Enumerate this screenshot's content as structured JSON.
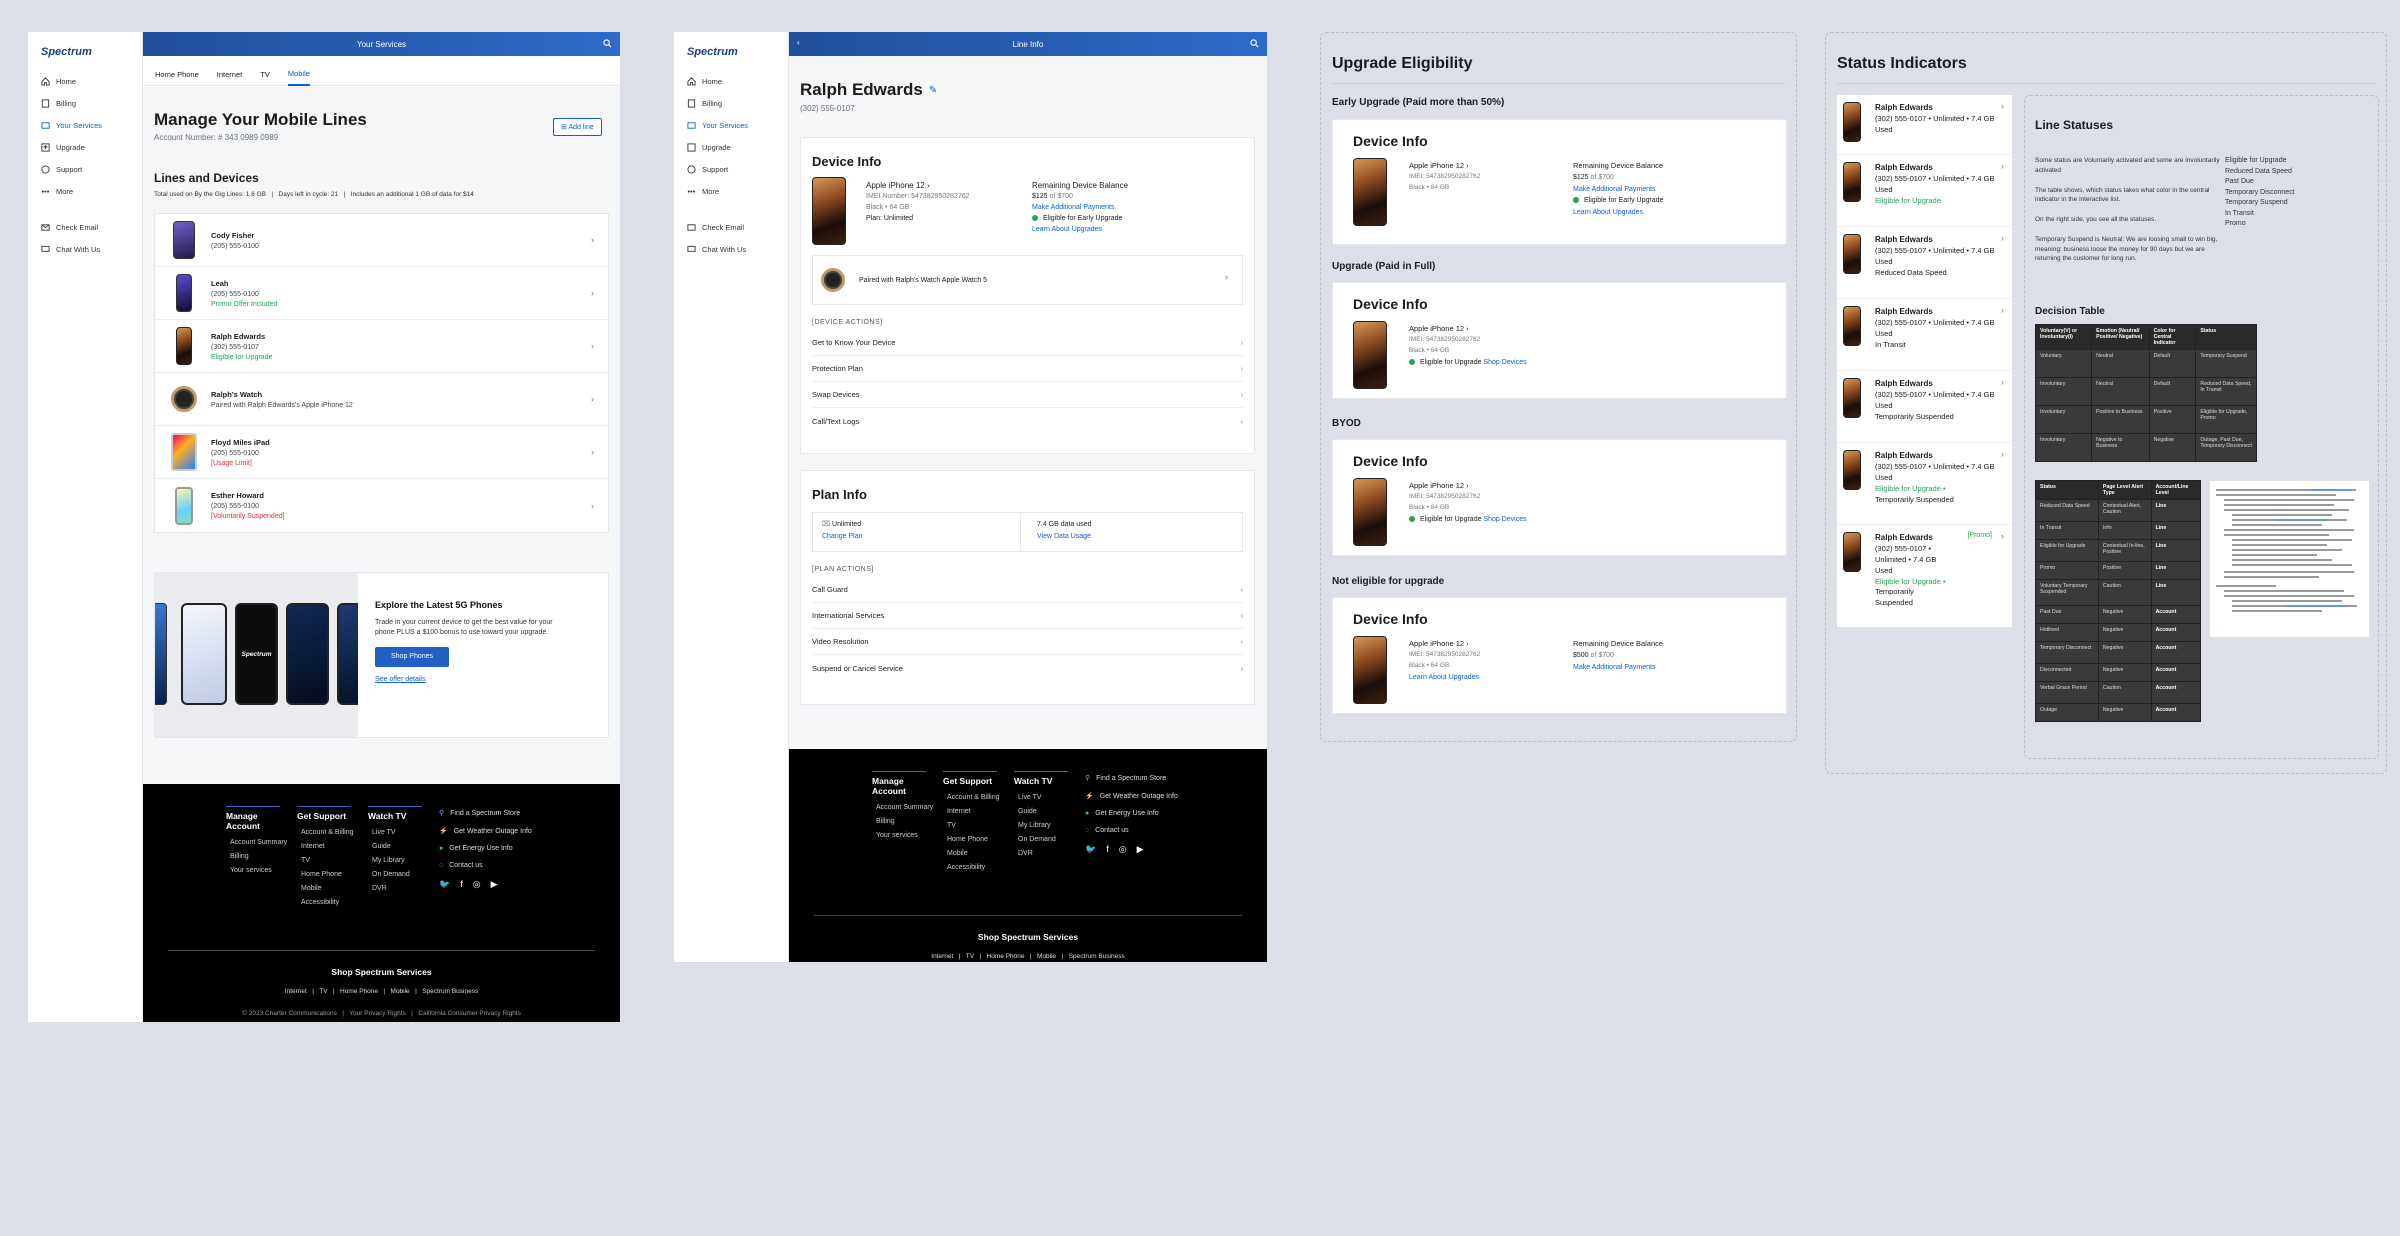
{
  "nav": {
    "logo": "Spectrum",
    "items": [
      "Home",
      "Billing",
      "Your Services",
      "Upgrade",
      "Support",
      "More"
    ],
    "extra": [
      "Check Email",
      "Chat With Us"
    ]
  },
  "screen1": {
    "topbar": "Your Services",
    "tabs": [
      "Home Phone",
      "Internet",
      "TV",
      "Mobile"
    ],
    "title": "Manage Your Mobile Lines",
    "account": "Account Number: # 343 0989 0989",
    "add_line": "Add line",
    "lines_title": "Lines and Devices",
    "usage_info": "Total used on By the Gig Lines: 1.6 GB   |   Days left in cycle: 21   |   Includes an additional 1 GB of data for $14",
    "lines": [
      {
        "name": "Cody Fisher",
        "phone": "(205) 555-0100",
        "status": ""
      },
      {
        "name": "Leah",
        "phone": "(205) 555-0100",
        "status": "Promo Offer Included"
      },
      {
        "name": "Ralph Edwards",
        "phone": "(302) 555-0107",
        "status": "Eligible for Upgrade"
      },
      {
        "name": "Ralph's Watch",
        "phone": "Paired with Ralph Edwards's Apple iPhone 12",
        "status": ""
      },
      {
        "name": "Floyd Miles iPad",
        "phone": "(205) 555-0100",
        "status": "[Usage Limit]"
      },
      {
        "name": "Esther Howard",
        "phone": "(205) 555-0100",
        "status": "[Voluntarily Suspended]"
      }
    ],
    "promo": {
      "title": "Explore the Latest 5G Phones",
      "body": "Trade in your current device to get the best value for your phone PLUS a $100 bonus to use toward your upgrade.",
      "button": "Shop Phones",
      "link": "See offer details",
      "phone_brand": "Spectrum"
    }
  },
  "screen2": {
    "topbar": "Line Info",
    "name": "Ralph Edwards",
    "phone": "(302) 555-0107",
    "device_info_title": "Device Info",
    "device": {
      "model": "Apple iPhone 12",
      "imei": "IMEI Number: 547382950282762",
      "spec": "Black  •  64 GB",
      "plan": "Plan: Unlimited"
    },
    "balance": {
      "label": "Remaining Device Balance",
      "amount": "$125",
      "of": "of $700",
      "payments": "Make Additional Payments",
      "eligible": "Eligible for Early Upgrade",
      "learn": "Learn About Upgrades"
    },
    "paired": "Paired with Ralph's Watch Apple Watch 5",
    "device_actions_label": "[DEVICE ACTIONS]",
    "device_actions": [
      "Get to Know Your Device",
      "Protection Plan",
      "Swap Devices",
      "Call/Text Logs"
    ],
    "plan_title": "Plan Info",
    "plan": {
      "name": "Unlimited",
      "change": "Change Plan",
      "data": "7.4 GB data used",
      "view": "View Data Usage"
    },
    "plan_actions_label": "[PLAN ACTIONS]",
    "plan_actions": [
      "Call Guard",
      "International Services",
      "Video Resolution",
      "Suspend  or Cancel Service"
    ]
  },
  "footer": {
    "cols": [
      {
        "title": "Manage Account",
        "items": [
          "Account Summary",
          "Billing",
          "Your services"
        ]
      },
      {
        "title": "Get Support",
        "items": [
          "Account & Billing",
          "Internet",
          "TV",
          "Home Phone",
          "Mobile",
          "Accessibility"
        ]
      },
      {
        "title": "Watch TV",
        "items": [
          "Live TV",
          "Guide",
          "My Library",
          "On Demand",
          "DVR"
        ]
      }
    ],
    "side": [
      "Find a Spectrum Store",
      "Get Weather Outage Info",
      "Get Energy Use Info",
      "Contact us"
    ],
    "shop": "Shop Spectrum Services",
    "links": "Internet   |   TV   |   Home Phone   |   Mobile   |   Spectrum Business",
    "copyright": "© 2023 Charter Communications   |   Your Privacy Rights   |   California Consumer Privacy Rights"
  },
  "upgrade": {
    "title": "Upgrade Eligibility",
    "groups": [
      {
        "label": "Early Upgrade (Paid more than 50%)",
        "device": "Apple iPhone 12",
        "imei": "IMEI: 547382950282762",
        "spec": "Black  •  64 GB",
        "balance_label": "Remaining Device Balance",
        "balance": "$125",
        "of": "of $700",
        "pay": "Make Additional Payments",
        "eligible": "Eligible for Early Upgrade",
        "learn": "Learn About Upgrades"
      },
      {
        "label": "Upgrade (Paid in Full)",
        "device": "Apple iPhone 12",
        "imei": "IMEI: 547382950282762",
        "spec": "Black  •  64 GB",
        "eligible": "Eligible for Upgrade",
        "shop": "Shop Devices"
      },
      {
        "label": "BYOD",
        "device": "Apple iPhone 12",
        "imei": "IMEI: 547382950282762",
        "spec": "Black  •  64 GB",
        "eligible": "Eligible for Upgrade",
        "shop": "Shop Devices"
      },
      {
        "label": "Not eligible for upgrade",
        "device": "Apple iPhone 12",
        "imei": "IMEI: 547382950282762",
        "spec": "Black  •  64 GB",
        "learn": "Learn About Upgrades",
        "balance_label": "Remaining Device Balance",
        "balance": "$500",
        "of": "of $700",
        "pay": "Make Additional Payments"
      }
    ],
    "device_info": "Device Info"
  },
  "status": {
    "title": "Status Indicators",
    "rows": [
      {
        "name": "Ralph Edwards",
        "detail": "(302) 555-0107  •  Unlimited  •  7.4 GB Used",
        "status": ""
      },
      {
        "name": "Ralph Edwards",
        "detail": "(302) 555-0107  •  Unlimited  •  7.4 GB Used",
        "status": "Eligible for Upgrade"
      },
      {
        "name": "Ralph Edwards",
        "detail": "(302) 555-0107  •  Unlimited  •  7.4 GB Used",
        "status": "Reduced Data Speed"
      },
      {
        "name": "Ralph Edwards",
        "detail": "(302) 555-0107  •  Unlimited  •  7.4 GB Used",
        "status": "In Transit"
      },
      {
        "name": "Ralph Edwards",
        "detail": "(302) 555-0107  •  Unlimited  •  7.4 GB Used",
        "status": "Temporarily Suspended"
      },
      {
        "name": "Ralph Edwards",
        "detail": "(302) 555-0107  •  Unlimited  •  7.4 GB Used",
        "status": "Eligible for Upgrade  •",
        "status2": "Temporarily Suspended"
      },
      {
        "name": "Ralph Edwards",
        "detail": "(302) 555-0107  •  Unlimited  •  7.4 GB Used",
        "status": "Eligible for Upgrade  •",
        "status2": "Temporarily Suspended",
        "promo": "[Promo]"
      }
    ],
    "line_statuses": {
      "title": "Line Statuses",
      "p1": "Some status are Voluntarily activated and some are involuntarily activated",
      "p2": "The table shows, which status takes what color in the central indicator in the interactive list.",
      "p3": "On the right side, you see all the statuses.",
      "p4": "Temporary Suspend is Neutral: We are loosing small to win big, meaning: business loose the money for 90 days but we are returning the customer for long run.",
      "list": [
        "Eligible for Upgrade",
        "Reduced Data Speed",
        "Past Due",
        "Temporary Disconnect",
        "Temporary Suspend",
        "In Transit",
        "Promo"
      ],
      "decision": "Decision Table"
    },
    "table1": {
      "head": [
        "Voluntary(V) or Involuntary(I)",
        "Emotion (Neutral/ Positive/ Negative)",
        "Color for Central Indicator",
        "Status"
      ],
      "rows": [
        [
          "Voluntary",
          "Neutral",
          "Default",
          "Temporary Suspend"
        ],
        [
          "Involuntary",
          "Neutral",
          "Default",
          "Reduced Data Speed, In Transit"
        ],
        [
          "Involuntary",
          "Positive to Business",
          "Positive",
          "Eligible for Upgrade, Promo"
        ],
        [
          "Involuntary",
          "Negative to Business",
          "Negative",
          "Outage, Past Due, Temporary Disconnect"
        ]
      ]
    },
    "table2": {
      "head": [
        "Status",
        "Page Level Alert Type",
        "Account/Line Level"
      ],
      "rows": [
        [
          "Reduced Data Speed",
          "Contextual Alert, Caution",
          "Line"
        ],
        [
          "In Transit",
          "Info",
          "Line"
        ],
        [
          "Eligible for Upgrade",
          "Contextual In-line, Positive",
          "Line"
        ],
        [
          "Promo",
          "Positive",
          "Line"
        ],
        [
          "Voluntary Temporary Suspended",
          "Caution",
          "Line"
        ],
        [
          "Past Due",
          "Negative",
          "Account"
        ],
        [
          "Hotlined",
          "Negative",
          "Account"
        ],
        [
          "Temporary Disconnect",
          "Negative",
          "Account"
        ],
        [
          "Disconnected",
          "Negative",
          "Account"
        ],
        [
          "Verbal Grace Period",
          "Caution",
          "Account"
        ],
        [
          "Outage",
          "Negative",
          "Account"
        ]
      ]
    }
  }
}
